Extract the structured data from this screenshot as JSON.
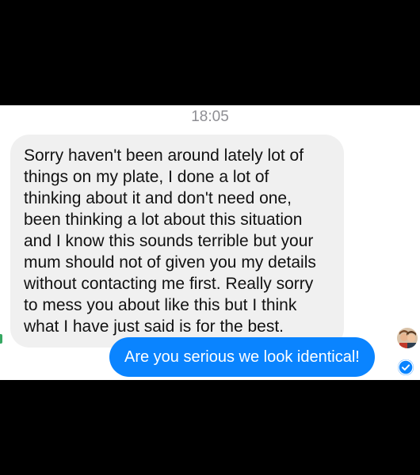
{
  "conversation": {
    "timestamp": "18:05",
    "incoming_message": "Sorry haven't been around lately lot of things on my plate, I done a lot of thinking about it and don't need one, been thinking a lot about this situation and I know this sounds terrible but your mum should not of given you my details without contacting me first. Really sorry to mess you about like this but I think what I have just said is for the best.",
    "outgoing_message": "Are you serious we look identical!",
    "seen_indicator_icon": "profile-avatar-icon",
    "delivered_icon": "check-circle-icon"
  },
  "colors": {
    "incoming_bubble": "#f0f0f0",
    "outgoing_bubble": "#0a84ff",
    "timestamp_text": "#8e8e93"
  }
}
